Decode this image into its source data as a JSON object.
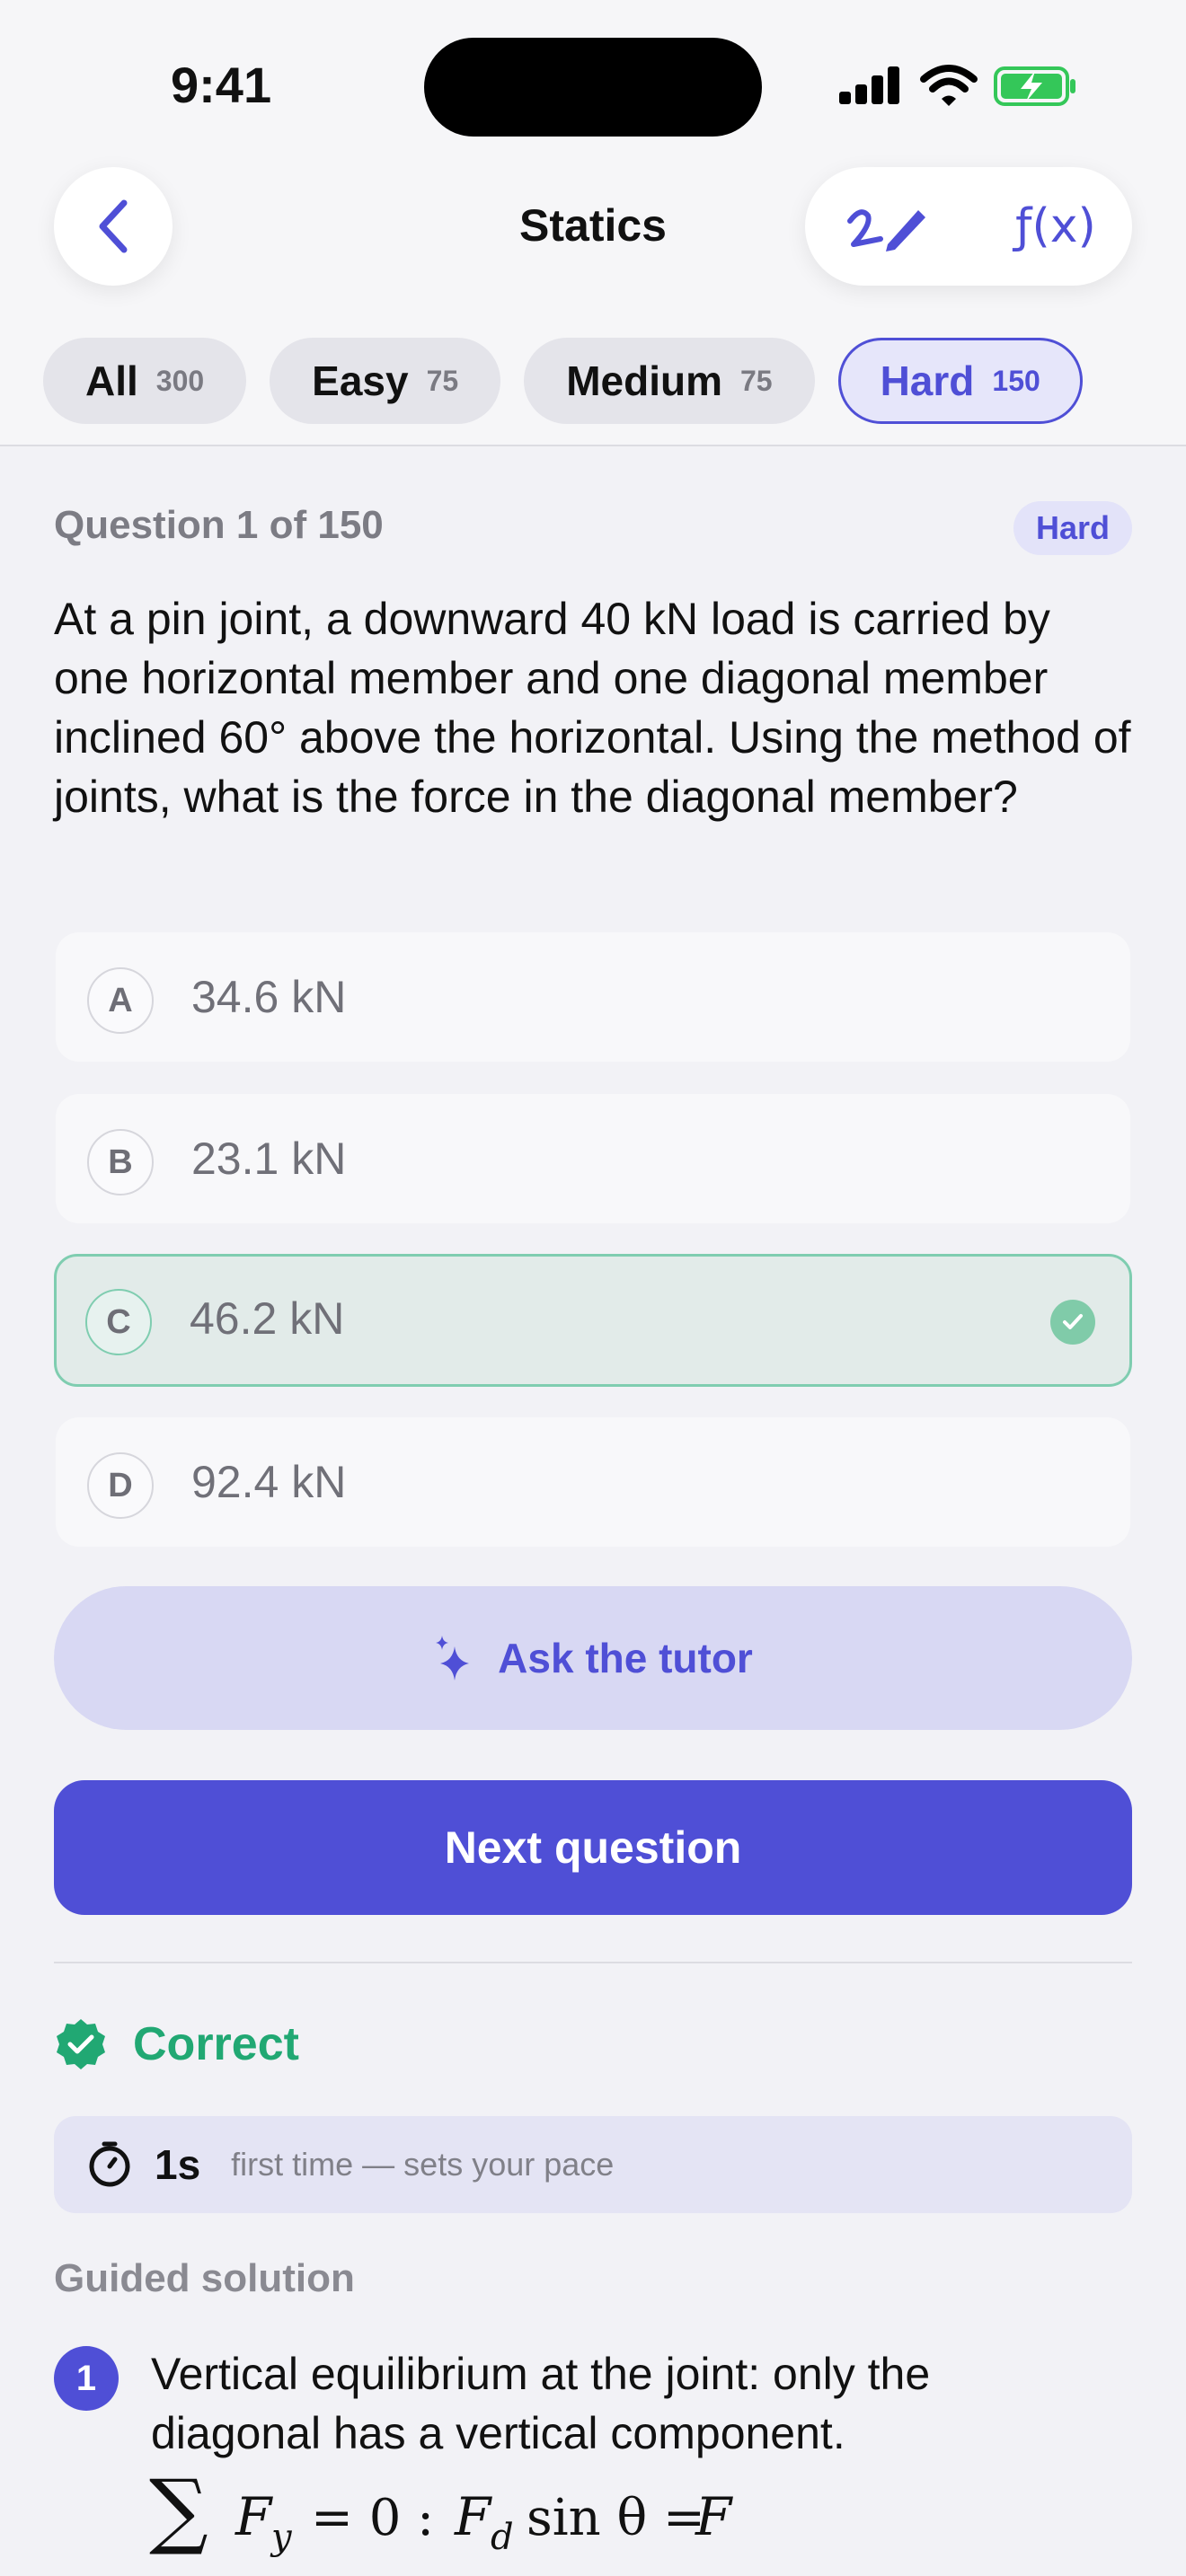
{
  "status_bar": {
    "time": "9:41"
  },
  "nav": {
    "title": "Statics",
    "fx_label": "ƒ(x)"
  },
  "filters": [
    {
      "label": "All",
      "count": "300"
    },
    {
      "label": "Easy",
      "count": "75"
    },
    {
      "label": "Medium",
      "count": "75"
    },
    {
      "label": "Hard",
      "count": "150"
    }
  ],
  "active_filter": "Hard",
  "question": {
    "counter": "Question 1 of 150",
    "difficulty": "Hard",
    "text": "At a pin joint, a downward 40 kN load is carried by one horizontal member and one diagonal member inclined 60° above the horizontal. Using the method of joints, what is the force in the diagonal member?"
  },
  "options": [
    {
      "letter": "A",
      "text": "34.6 kN"
    },
    {
      "letter": "B",
      "text": "23.1 kN"
    },
    {
      "letter": "C",
      "text": "46.2 kN"
    },
    {
      "letter": "D",
      "text": "92.4 kN"
    }
  ],
  "correct_option": "C",
  "buttons": {
    "tutor": "Ask the tutor",
    "next": "Next question"
  },
  "result": {
    "label": "Correct"
  },
  "timing": {
    "value": "1s",
    "note": "first time — sets your pace"
  },
  "solution": {
    "title": "Guided solution",
    "steps": [
      {
        "number": "1",
        "text": "Vertical equilibrium at the joint: only the diagonal has a vertical component.",
        "equation": {
          "lhs_sum": "∑",
          "lhs_var": "F",
          "lhs_sub": "y",
          "lhs_rhs": "= 0 :",
          "rhs_var": "F",
          "rhs_sub": "d",
          "rhs_func": "sin θ =",
          "rhs_end": "F"
        }
      }
    ]
  },
  "colors": {
    "accent": "#4f4fd6",
    "correct": "#21a873",
    "correct_border": "#7fcdb0"
  }
}
